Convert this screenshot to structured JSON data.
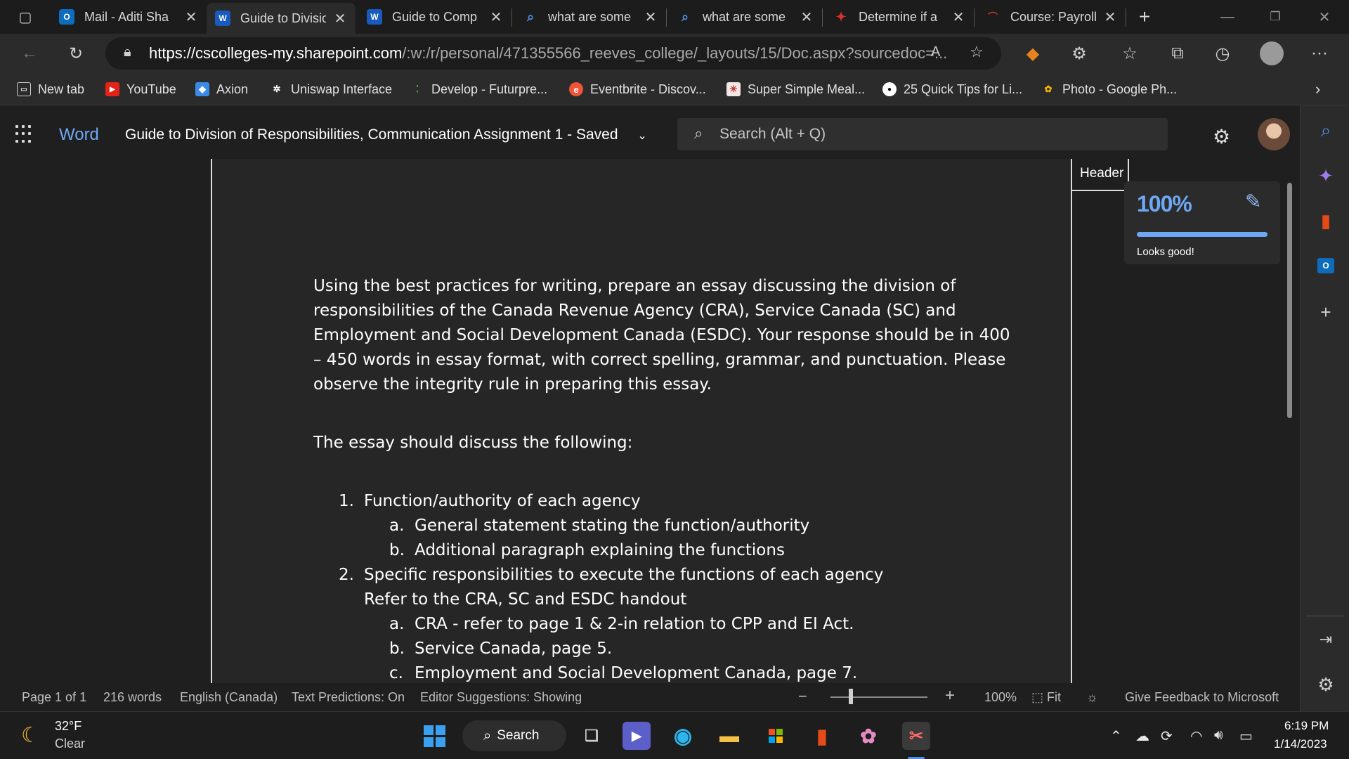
{
  "browser": {
    "tabs": [
      {
        "label": "Mail - Aditi Sha",
        "icon": "outlook-icon",
        "active": false
      },
      {
        "label": "Guide to Divisio",
        "icon": "word-icon",
        "active": true
      },
      {
        "label": "Guide to Comp",
        "icon": "word-icon",
        "active": false
      },
      {
        "label": "what are some",
        "icon": "search-icon",
        "active": false
      },
      {
        "label": "what are some",
        "icon": "search-icon",
        "active": false
      },
      {
        "label": "Determine if a",
        "icon": "maple-leaf-icon",
        "active": false
      },
      {
        "label": "Course: Payroll",
        "icon": "course-icon",
        "active": false
      }
    ],
    "url_host": "https://cscolleges-my.sharepoint.com",
    "url_rest": "/:w:/r/personal/471355566_reeves_college/_layouts/15/Doc.aspx?sourcedoc=...",
    "bookmarks": [
      {
        "label": "New tab",
        "icon": "newtab-icon"
      },
      {
        "label": "YouTube",
        "icon": "youtube-icon"
      },
      {
        "label": "Axion",
        "icon": "axion-icon"
      },
      {
        "label": "Uniswap Interface",
        "icon": "uniswap-icon"
      },
      {
        "label": "Develop - Futurpre...",
        "icon": "develop-icon"
      },
      {
        "label": "Eventbrite - Discov...",
        "icon": "eventbrite-icon"
      },
      {
        "label": "Super Simple Meal...",
        "icon": "meal-icon"
      },
      {
        "label": "25 Quick Tips for Li...",
        "icon": "medium-icon"
      },
      {
        "label": "Photo - Google Ph...",
        "icon": "google-photos-icon"
      }
    ]
  },
  "word": {
    "app_name": "Word",
    "doc_title": "Guide to Division of Responsibilities, Communication Assignment 1  -  Saved",
    "search_placeholder": "Search (Alt + Q)",
    "header_tag": "Header",
    "editor": {
      "score_label": "100%",
      "score": 100,
      "message": "Looks good!"
    }
  },
  "document": {
    "intro": "Using the best practices for writing, prepare an essay discussing the division of responsibilities of the Canada Revenue Agency (CRA), Service Canada (SC) and Employment and Social Development Canada (ESDC). Your response should be in 400 – 450 words in essay format, with correct spelling, grammar, and punctuation. Please observe the integrity rule in preparing this essay.",
    "lead": "The essay should discuss the following:",
    "items": [
      {
        "num": "1.",
        "text": "Function/authority of each agency"
      },
      {
        "num": "a.",
        "text": "General statement stating the function/authority"
      },
      {
        "num": "b.",
        "text": "Additional paragraph explaining the functions"
      },
      {
        "num": "2.",
        "text": "Specific responsibilities to execute the functions of each agency"
      },
      {
        "num": "",
        "text": "Refer to the CRA, SC and ESDC handout"
      },
      {
        "num": "a.",
        "text": "CRA - refer to page 1 & 2-in relation to CPP and EI Act."
      },
      {
        "num": "b.",
        "text": "Service Canada, page 5."
      },
      {
        "num": "c.",
        "text": "Employment and Social Development Canada, page 7."
      }
    ]
  },
  "status": {
    "page": "Page 1 of 1",
    "words": "216 words",
    "language": "English (Canada)",
    "predictions": "Text Predictions: On",
    "editor_suggestions": "Editor Suggestions: Showing",
    "zoom": "100%",
    "fit": "Fit",
    "feedback": "Give Feedback to Microsoft"
  },
  "taskbar": {
    "temp": "32°F",
    "weather": "Clear",
    "search_label": "Search",
    "time": "6:19 PM",
    "date": "1/14/2023"
  },
  "colors": {
    "accent": "#6ea8f5",
    "word_blue": "#185abd",
    "outlook_blue": "#0f6cbd"
  }
}
